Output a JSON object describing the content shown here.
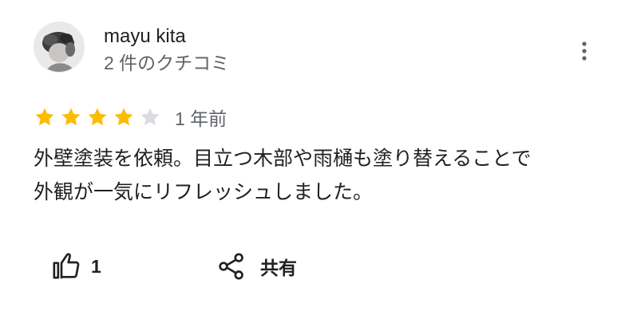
{
  "author": {
    "name": "mayu kita",
    "meta": "2 件のクチコミ"
  },
  "rating": {
    "value": 4,
    "max": 5,
    "filled_color": "#fbbc04",
    "empty_color": "#dadce0",
    "date": "1 年前"
  },
  "review": {
    "lines": [
      "外壁塗装を依頼。目立つ木部や雨樋も塗り替えることで",
      "外観が一気にリフレッシュしました。"
    ]
  },
  "actions": {
    "like_icon": "thumbs-up-icon",
    "like_count": "1",
    "share_icon": "share-icon",
    "share_label": "共有"
  },
  "menu_icon": "more-vert-icon"
}
